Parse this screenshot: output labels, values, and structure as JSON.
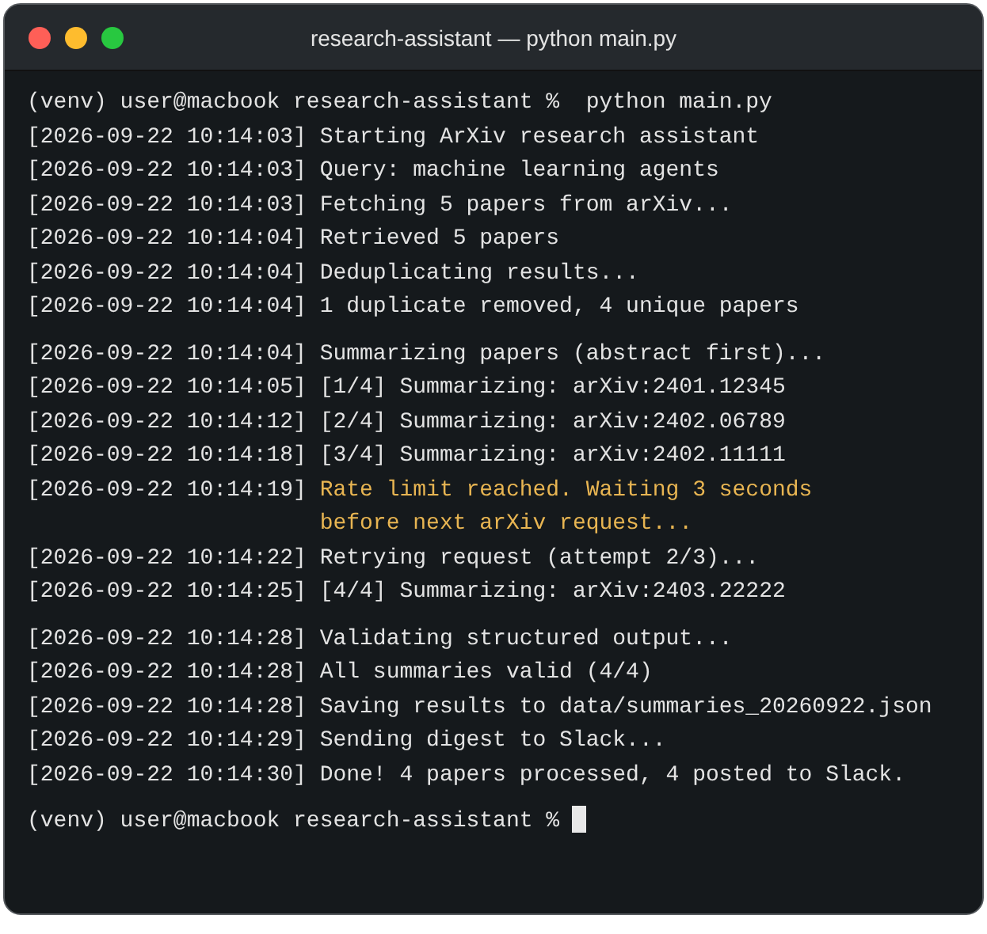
{
  "window": {
    "title": "research-assistant — python main.py"
  },
  "terminal": {
    "command_prompt": {
      "prompt": "(venv) user@macbook research-assistant %",
      "command": "python main.py"
    },
    "groups": [
      {
        "lines": [
          {
            "timestamp": "[2026-09-22 10:14:03]",
            "message": "Starting ArXiv research assistant",
            "kind": "info"
          },
          {
            "timestamp": "[2026-09-22 10:14:03]",
            "message": "Query: machine learning agents",
            "kind": "info"
          },
          {
            "timestamp": "[2026-09-22 10:14:03]",
            "message": "Fetching 5 papers from arXiv...",
            "kind": "info"
          },
          {
            "timestamp": "[2026-09-22 10:14:04]",
            "message": "Retrieved 5 papers",
            "kind": "info"
          },
          {
            "timestamp": "[2026-09-22 10:14:04]",
            "message": "Deduplicating results...",
            "kind": "info"
          },
          {
            "timestamp": "[2026-09-22 10:14:04]",
            "message": "1 duplicate removed, 4 unique papers",
            "kind": "info"
          }
        ]
      },
      {
        "lines": [
          {
            "timestamp": "[2026-09-22 10:14:04]",
            "message": "Summarizing papers (abstract first)...",
            "kind": "info"
          },
          {
            "timestamp": "[2026-09-22 10:14:05]",
            "message": "[1/4] Summarizing: arXiv:2401.12345",
            "kind": "info"
          },
          {
            "timestamp": "[2026-09-22 10:14:12]",
            "message": "[2/4] Summarizing: arXiv:2402.06789",
            "kind": "info"
          },
          {
            "timestamp": "[2026-09-22 10:14:18]",
            "message": "[3/4] Summarizing: arXiv:2402.11111",
            "kind": "info"
          },
          {
            "timestamp": "[2026-09-22 10:14:19]",
            "message": "Rate limit reached. Waiting 3 seconds before next arXiv request...",
            "kind": "warning"
          },
          {
            "timestamp": "[2026-09-22 10:14:22]",
            "message": "Retrying request (attempt 2/3)...",
            "kind": "info"
          },
          {
            "timestamp": "[2026-09-22 10:14:25]",
            "message": "[4/4] Summarizing: arXiv:2403.22222",
            "kind": "info"
          }
        ]
      },
      {
        "lines": [
          {
            "timestamp": "[2026-09-22 10:14:28]",
            "message": "Validating structured output...",
            "kind": "info"
          },
          {
            "timestamp": "[2026-09-22 10:14:28]",
            "message": "All summaries valid (4/4)",
            "kind": "info"
          },
          {
            "timestamp": "[2026-09-22 10:14:28]",
            "message": "Saving results to data/summaries_20260922.json",
            "kind": "info"
          },
          {
            "timestamp": "[2026-09-22 10:14:29]",
            "message": "Sending digest to Slack...",
            "kind": "info"
          },
          {
            "timestamp": "[2026-09-22 10:14:30]",
            "message": "Done! 4 papers processed, 4 posted to Slack.",
            "kind": "info"
          }
        ]
      }
    ],
    "final_prompt": {
      "prompt": "(venv) user@macbook research-assistant %",
      "cursor": true
    }
  }
}
